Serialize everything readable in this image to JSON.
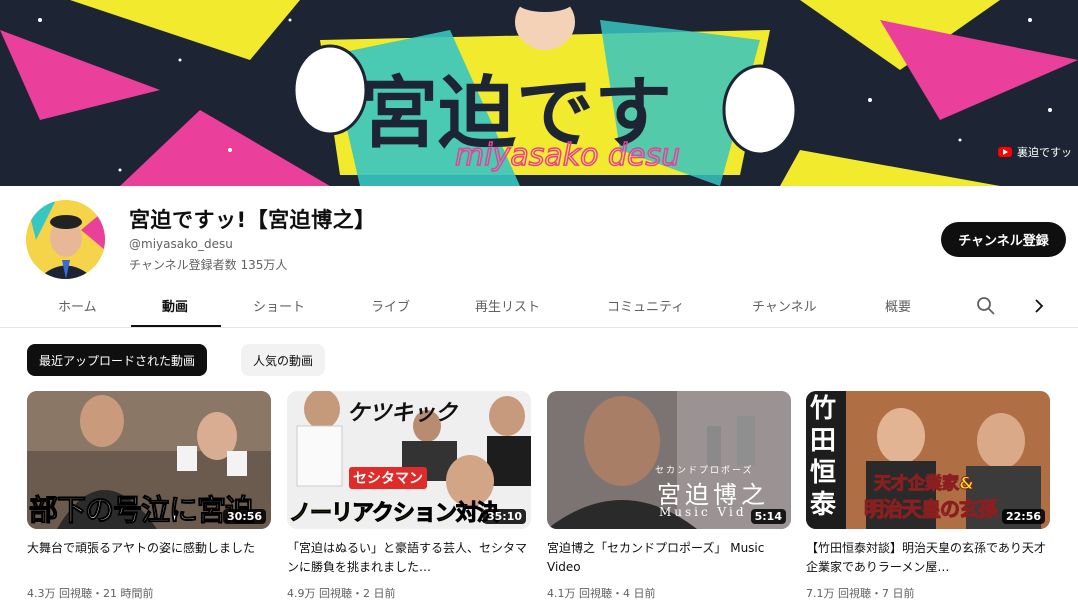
{
  "banner": {
    "link_label": "裏迫ですッ",
    "colors": {
      "bg": "#1d2433",
      "yellow": "#f2ea2c",
      "pink": "#ea3f9a",
      "cyan": "#37c6c2"
    }
  },
  "channel": {
    "name": "宮迫ですッ!【宮迫博之】",
    "handle": "@miyasako_desu",
    "subscribers": "チャンネル登録者数 135万人",
    "subscribe_label": "チャンネル登録"
  },
  "tabs": [
    {
      "label": "ホーム"
    },
    {
      "label": "動画"
    },
    {
      "label": "ショート"
    },
    {
      "label": "ライブ"
    },
    {
      "label": "再生リスト"
    },
    {
      "label": "コミュニティ"
    },
    {
      "label": "チャンネル"
    },
    {
      "label": "概要"
    }
  ],
  "tab_icons": {
    "search": "search-icon",
    "next": "chevron-right-icon"
  },
  "chips": [
    {
      "label": "最近アップロードされた動画"
    },
    {
      "label": "人気の動画"
    }
  ],
  "videos": [
    {
      "title": "大舞台で頑張るアヤトの姿に感動しました",
      "meta": "4.3万 回視聴・21 時間前",
      "duration": "30:56",
      "overlay": "部下の号泣に宮迫に"
    },
    {
      "title": "「宮迫はぬるい」と豪語する芸人、セシタマンに勝負を挑まれました…",
      "meta": "4.9万 回視聴・2 日前",
      "duration": "35:10",
      "overlay": "ノーリアクション対決",
      "overlay2": "セシタマン",
      "overlay3": "ケツキック"
    },
    {
      "title": "宮迫博之「セカンドプロポーズ」 Music Video",
      "meta": "4.1万 回視聴・4 日前",
      "duration": "5:14",
      "overlay": "宮迫博之",
      "overlay2": "セカンドプロポーズ",
      "overlay3": "Music Vid"
    },
    {
      "title": "【竹田恒泰対談】明治天皇の玄孫であり天才企業家でありラーメン屋…",
      "meta": "7.1万 回視聴・7 日前",
      "duration": "22:56",
      "overlay": "明治天皇の玄孫",
      "overlay2": "天才企業家&",
      "overlay3": "竹田恒泰"
    }
  ]
}
